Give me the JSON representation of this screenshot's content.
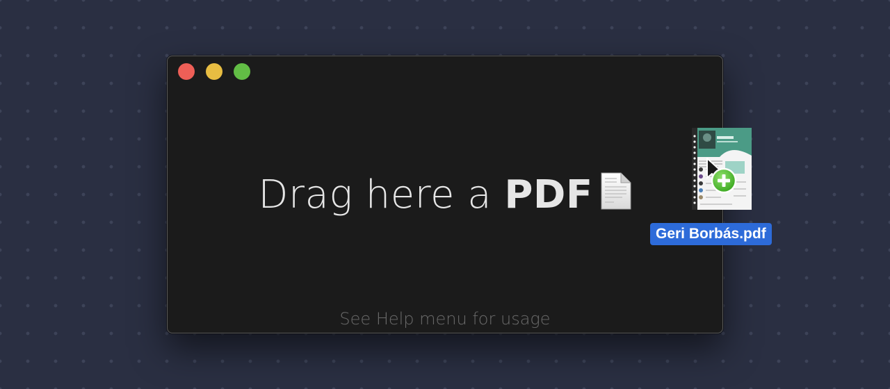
{
  "window": {
    "traffic_lights": [
      {
        "name": "close",
        "color": "#ee5f57"
      },
      {
        "name": "minimize",
        "color": "#e8bd42"
      },
      {
        "name": "zoom",
        "color": "#62bd45"
      }
    ]
  },
  "main": {
    "prompt_prefix": "Drag here a ",
    "prompt_bold": "PDF",
    "prompt_icon": "document-icon",
    "help_text": "See Help menu for usage"
  },
  "drag_item": {
    "filename": "Geri Borbás.pdf",
    "icons": [
      "pdf-thumbnail-icon",
      "cursor-arrow-icon",
      "copy-plus-badge-icon"
    ],
    "label_color": "#2d6bd9"
  }
}
